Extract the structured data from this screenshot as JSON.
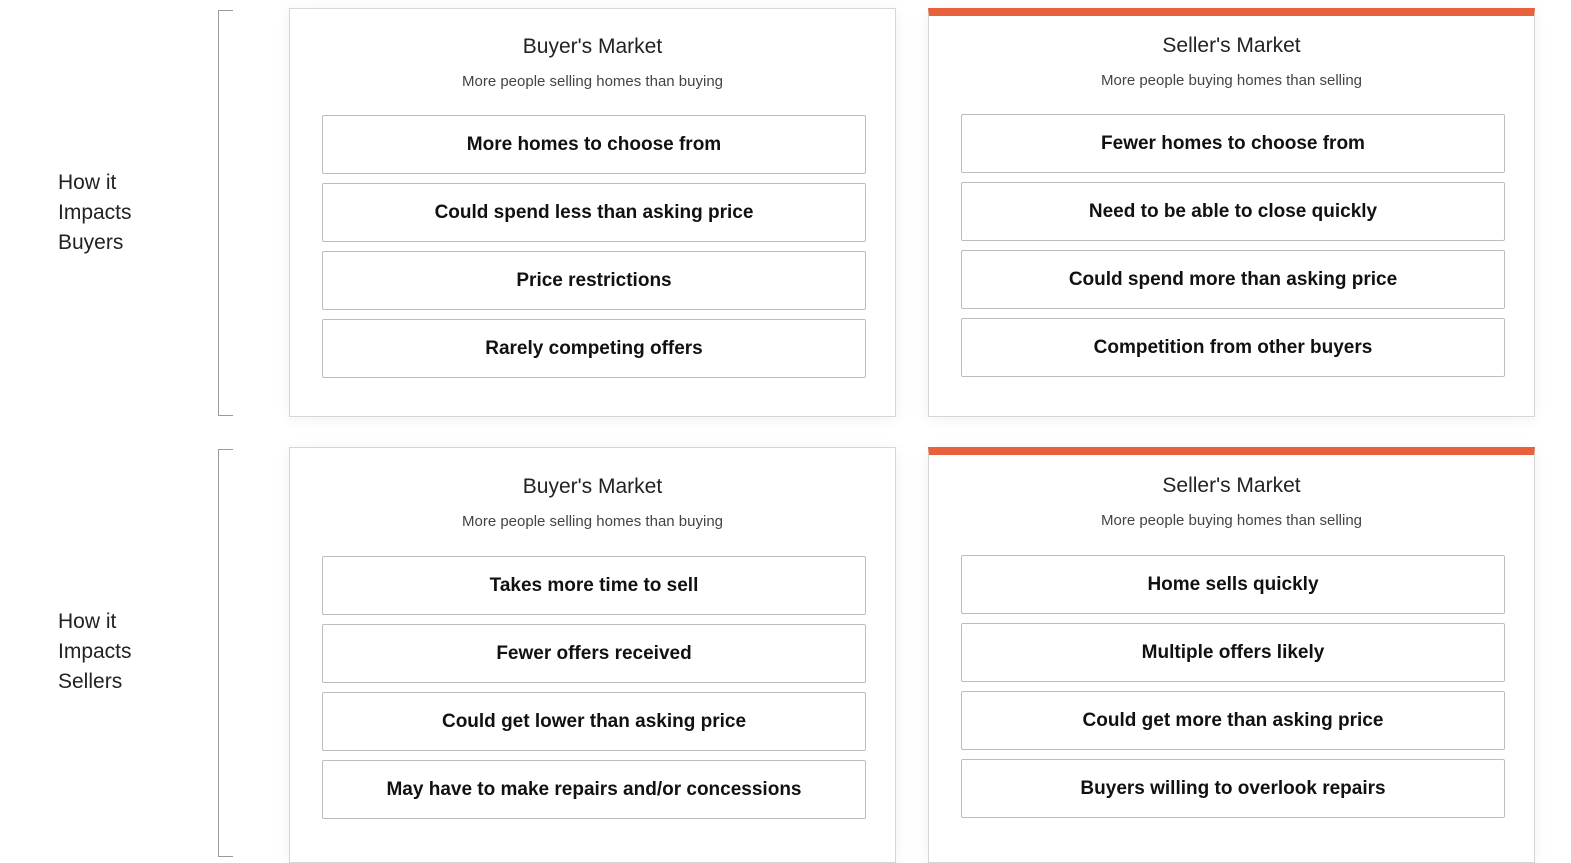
{
  "rows": [
    {
      "label": "How it\nImpacts\nBuyers",
      "cards": [
        {
          "title": "Buyer's Market",
          "subtitle": "More people selling homes than buying",
          "highlighted": false,
          "items": [
            "More homes to choose from",
            "Could spend less than asking price",
            "Price restrictions",
            "Rarely competing offers"
          ]
        },
        {
          "title": "Seller's Market",
          "subtitle": "More people buying homes than selling",
          "highlighted": true,
          "items": [
            "Fewer homes to choose from",
            "Need to be able to close quickly",
            "Could spend more than asking price",
            "Competition from other buyers"
          ]
        }
      ]
    },
    {
      "label": "How it\nImpacts\nSellers",
      "cards": [
        {
          "title": "Buyer's Market",
          "subtitle": "More people selling homes than buying",
          "highlighted": false,
          "items": [
            "Takes more time to sell",
            "Fewer offers received",
            "Could get lower than asking price",
            "May have to make repairs and/or concessions"
          ]
        },
        {
          "title": "Seller's Market",
          "subtitle": "More people buying homes than selling",
          "highlighted": true,
          "items": [
            "Home sells quickly",
            "Multiple offers likely",
            "Could get more than asking price",
            "Buyers willing to overlook repairs"
          ]
        }
      ]
    }
  ],
  "colors": {
    "accent": "#e8603c",
    "border": "#bdbdbd"
  }
}
